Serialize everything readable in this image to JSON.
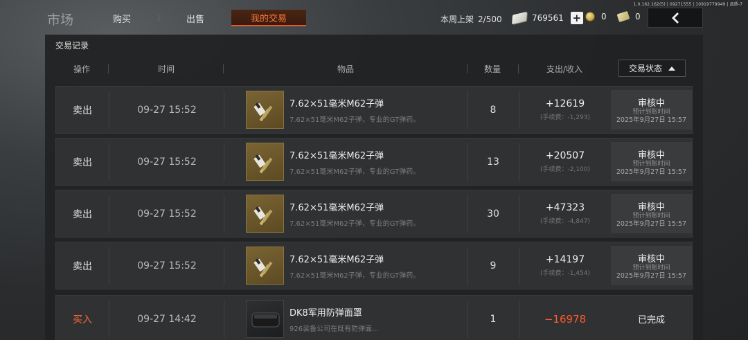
{
  "build_info": "1.0.162.162(5) | 09271555 | 10919779949 | 品质-7",
  "app": {
    "title": "市场",
    "tabs": [
      {
        "label": "购买",
        "active": false
      },
      {
        "label": "出售",
        "active": false
      },
      {
        "label": "我的交易",
        "active": true
      }
    ]
  },
  "header_bar": {
    "week_listing_label": "本周上架",
    "week_listing_value": "2/500",
    "cash_value": "769561",
    "plus_label": "+",
    "coin_value": "0",
    "ticket_value": "0"
  },
  "panel": {
    "title": "交易记录",
    "columns": [
      "操作",
      "时间",
      "物品",
      "数量",
      "支出/收入"
    ],
    "status_column": "交易状态",
    "rows": [
      {
        "op": "卖出",
        "time": "09-27 15:52",
        "item_name": "7.62×51毫米M62子弹",
        "item_desc": "7.62×51毫米M62子弹，专业的GT弹药。",
        "qty": "8",
        "amount": "+12619",
        "fee": "(手续费：-1,293)",
        "status": "审核中",
        "status_sub": "预计到账时间",
        "status_date": "2025年9月27日 15:57"
      },
      {
        "op": "卖出",
        "time": "09-27 15:52",
        "item_name": "7.62×51毫米M62子弹",
        "item_desc": "7.62×51毫米M62子弹，专业的GT弹药。",
        "qty": "13",
        "amount": "+20507",
        "fee": "(手续费：-2,100)",
        "status": "审核中",
        "status_sub": "预计到账时间",
        "status_date": "2025年9月27日 15:57"
      },
      {
        "op": "卖出",
        "time": "09-27 15:52",
        "item_name": "7.62×51毫米M62子弹",
        "item_desc": "7.62×51毫米M62子弹，专业的GT弹药。",
        "qty": "30",
        "amount": "+47323",
        "fee": "(手续费：-4,847)",
        "status": "审核中",
        "status_sub": "预计到账时间",
        "status_date": "2025年9月27日 15:57"
      },
      {
        "op": "卖出",
        "time": "09-27 15:52",
        "item_name": "7.62×51毫米M62子弹",
        "item_desc": "7.62×51毫米M62子弹，专业的GT弹药。",
        "qty": "9",
        "amount": "+14197",
        "fee": "(手续费：-1,454)",
        "status": "审核中",
        "status_sub": "预计到账时间",
        "status_date": "2025年9月27日 15:57"
      },
      {
        "op": "买入",
        "time": "09-27 14:42",
        "item_name": "DK8军用防弹面罩",
        "item_desc": "926装备公司在既有防弹面...",
        "qty": "1",
        "amount": "−16978",
        "status": "已完成"
      }
    ]
  },
  "colors": {
    "accent": "#ff6633",
    "negative": "#ff5a2a",
    "panel_bg": "#212223",
    "row_bg": "#303132"
  },
  "icons": [
    "cash-icon",
    "plus-icon",
    "coin-icon",
    "ticket-icon",
    "back-arrow-icon",
    "sort-caret-up-icon",
    "ammo-item-icon",
    "mask-item-icon"
  ]
}
